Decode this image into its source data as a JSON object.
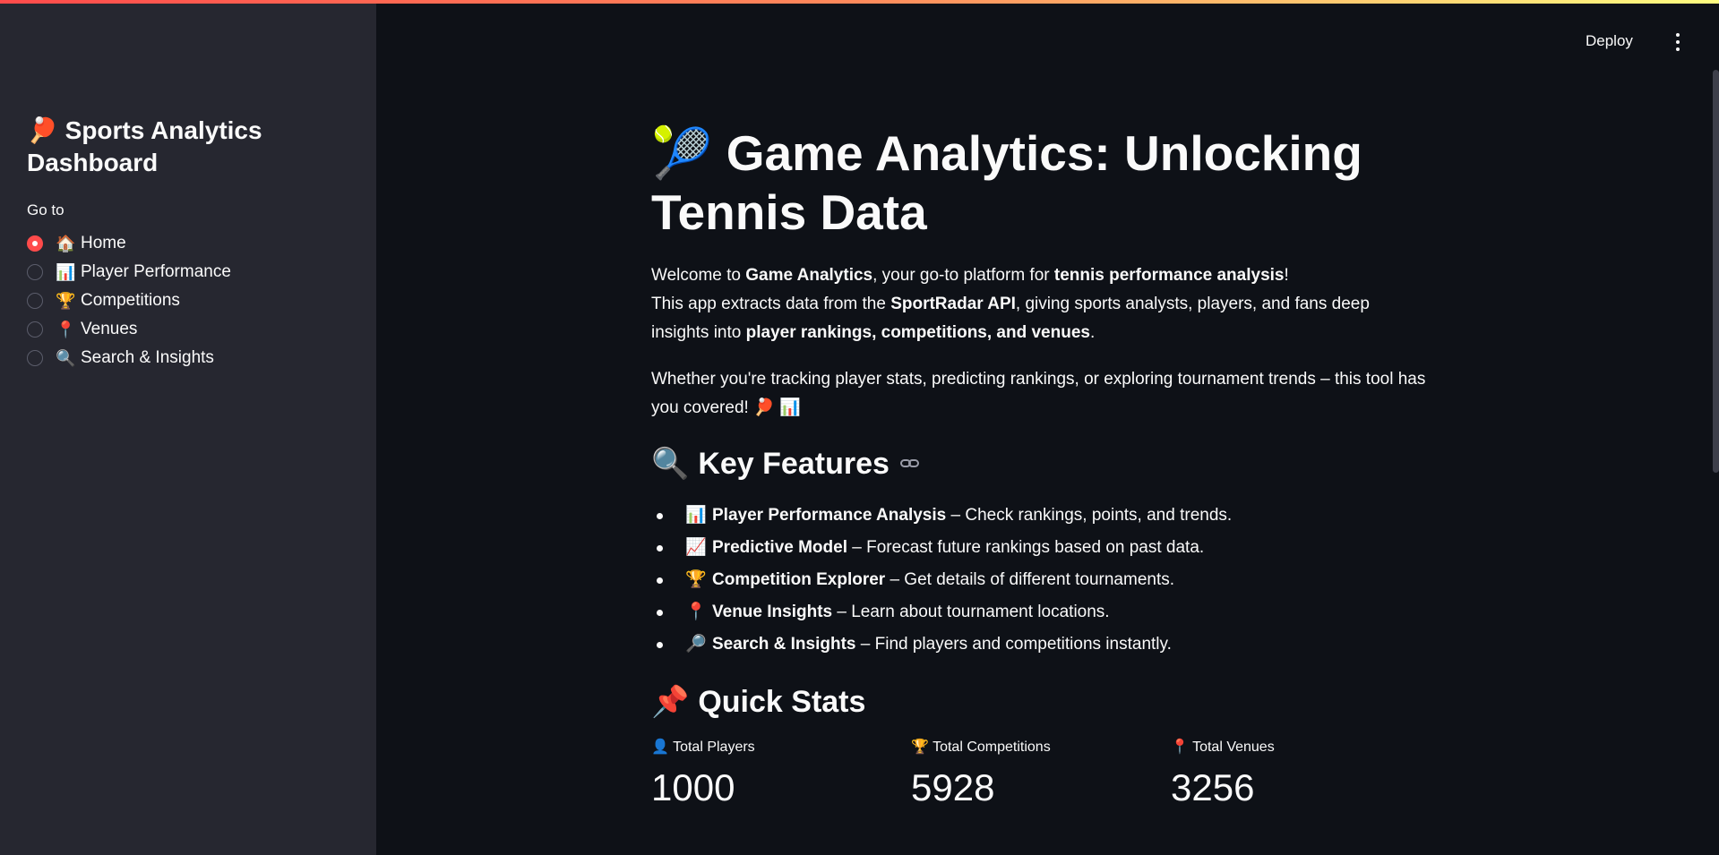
{
  "sidebar": {
    "title_emoji": "🏓",
    "title": "Sports Analytics Dashboard",
    "goto_label": "Go to",
    "items": [
      {
        "emoji": "🏠",
        "label": "Home",
        "selected": true
      },
      {
        "emoji": "📊",
        "label": "Player Performance",
        "selected": false
      },
      {
        "emoji": "🏆",
        "label": "Competitions",
        "selected": false
      },
      {
        "emoji": "📍",
        "label": "Venues",
        "selected": false
      },
      {
        "emoji": "🔍",
        "label": "Search & Insights",
        "selected": false
      }
    ]
  },
  "header": {
    "deploy_label": "Deploy"
  },
  "main": {
    "title_emoji": "🎾",
    "title": "Game Analytics: Unlocking Tennis Data",
    "intro": {
      "p1_a": "Welcome to ",
      "p1_b": "Game Analytics",
      "p1_c": ", your go-to platform for ",
      "p1_d": "tennis performance analysis",
      "p1_e": "!",
      "p2_a": "This app extracts data from the ",
      "p2_b": "SportRadar API",
      "p2_c": ", giving sports analysts, players, and fans deep insights into ",
      "p2_d": "player rankings, competitions, and venues",
      "p2_e": "."
    },
    "tagline": "Whether you're tracking player stats, predicting rankings, or exploring tournament trends – this tool has you covered! 🏓 📊",
    "features_heading_emoji": "🔍",
    "features_heading": "Key Features",
    "features": [
      {
        "emoji": "📊",
        "title": "Player Performance Analysis",
        "desc": " – Check rankings, points, and trends."
      },
      {
        "emoji": "📈",
        "title": "Predictive Model",
        "desc": " – Forecast future rankings based on past data."
      },
      {
        "emoji": "🏆",
        "title": "Competition Explorer",
        "desc": " – Get details of different tournaments."
      },
      {
        "emoji": "📍",
        "title": "Venue Insights",
        "desc": " – Learn about tournament locations."
      },
      {
        "emoji": "🔎",
        "title": "Search & Insights",
        "desc": " – Find players and competitions instantly."
      }
    ],
    "stats_heading_emoji": "📌",
    "stats_heading": "Quick Stats",
    "stats": [
      {
        "emoji": "👤",
        "label": "Total Players",
        "value": "1000"
      },
      {
        "emoji": "🏆",
        "label": "Total Competitions",
        "value": "5928"
      },
      {
        "emoji": "📍",
        "label": "Total Venues",
        "value": "3256"
      }
    ]
  }
}
